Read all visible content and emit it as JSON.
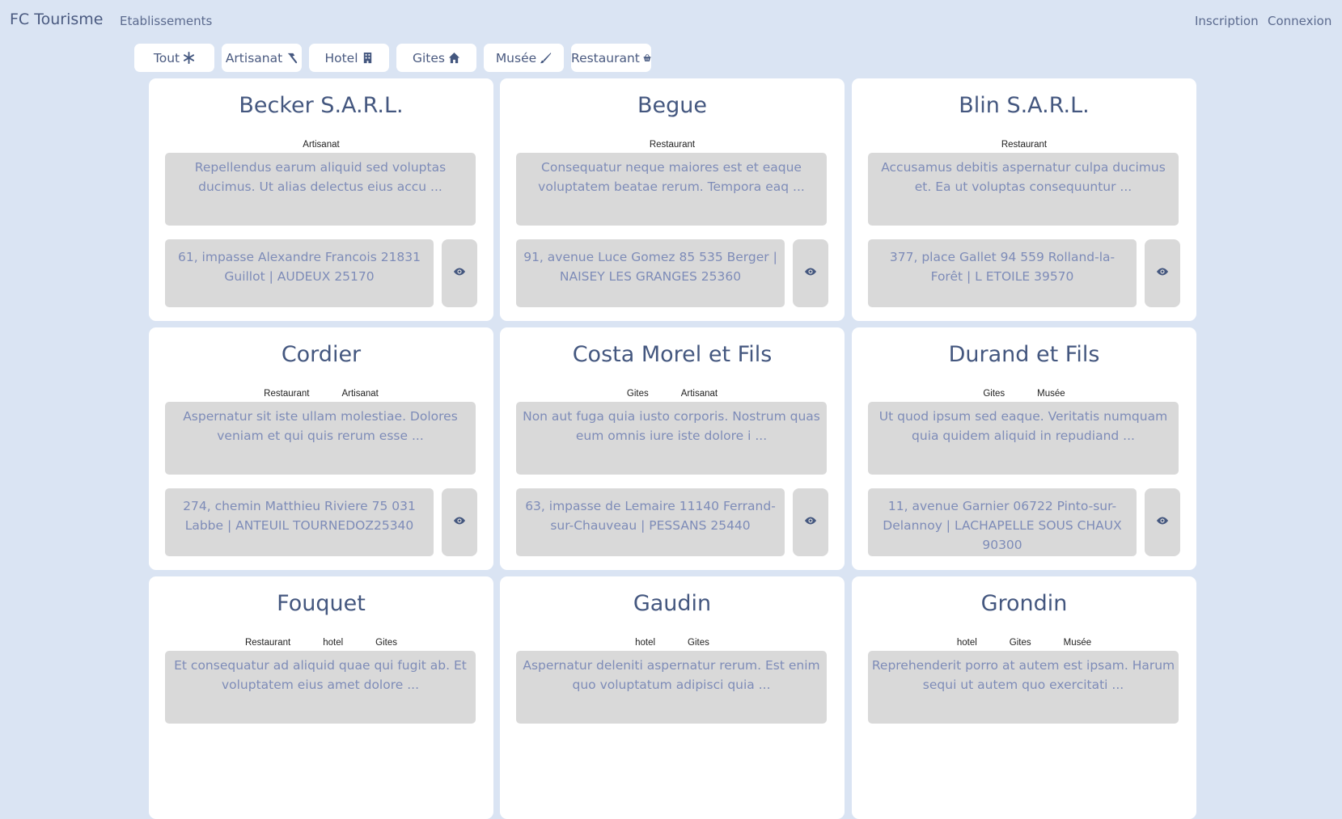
{
  "navbar": {
    "brand": "FC Tourisme",
    "establishments": "Etablissements",
    "signup": "Inscription",
    "login": "Connexion"
  },
  "filters": [
    {
      "label": "Tout",
      "icon": "asterisk-icon"
    },
    {
      "label": "Artisanat",
      "icon": "hammer-icon"
    },
    {
      "label": "Hotel",
      "icon": "building-icon"
    },
    {
      "label": "Gites",
      "icon": "house-icon"
    },
    {
      "label": "Musée",
      "icon": "brush-icon"
    },
    {
      "label": "Restaurant",
      "icon": "basket-icon"
    }
  ],
  "cards": [
    {
      "title": "Becker S.A.R.L.",
      "tags": [
        "Artisanat"
      ],
      "description": "Repellendus earum aliquid sed voluptas ducimus. Ut alias delectus eius accu ...",
      "address": "61, impasse Alexandre Francois 21831 Guillot | AUDEUX 25170"
    },
    {
      "title": "Begue",
      "tags": [
        "Restaurant"
      ],
      "description": "Consequatur neque maiores est et eaque voluptatem beatae rerum. Tempora eaq ...",
      "address": "91, avenue Luce Gomez 85 535 Berger | NAISEY LES GRANGES 25360"
    },
    {
      "title": "Blin S.A.R.L.",
      "tags": [
        "Restaurant"
      ],
      "description": "Accusamus debitis aspernatur culpa ducimus et. Ea ut voluptas consequuntur ...",
      "address": "377, place Gallet 94 559 Rolland-la-Forêt | L ETOILE 39570"
    },
    {
      "title": "Cordier",
      "tags": [
        "Restaurant",
        "Artisanat"
      ],
      "description": "Aspernatur sit iste ullam molestiae. Dolores veniam et qui quis rerum esse ...",
      "address": "274, chemin Matthieu Riviere 75 031 Labbe | ANTEUIL TOURNEDOZ25340"
    },
    {
      "title": "Costa Morel et Fils",
      "tags": [
        "Gites",
        "Artisanat"
      ],
      "description": "Non aut fuga quia iusto corporis. Nostrum quas eum omnis iure iste dolore i ...",
      "address": "63, impasse de Lemaire 11140 Ferrand-sur-Chauveau | PESSANS 25440"
    },
    {
      "title": "Durand et Fils",
      "tags": [
        "Gites",
        "Musée"
      ],
      "description": "Ut quod ipsum sed eaque. Veritatis numquam quia quidem aliquid in repudiand ...",
      "address": "11, avenue Garnier 06722 Pinto-sur-Delannoy | LACHAPELLE SOUS CHAUX 90300"
    },
    {
      "title": "Fouquet",
      "tags": [
        "Restaurant",
        "hotel",
        "Gites"
      ],
      "description": "Et consequatur ad aliquid quae qui fugit ab. Et voluptatem eius amet dolore ...",
      "address": ""
    },
    {
      "title": "Gaudin",
      "tags": [
        "hotel",
        "Gites"
      ],
      "description": "Aspernatur deleniti aspernatur rerum. Est enim quo voluptatum adipisci quia ...",
      "address": ""
    },
    {
      "title": "Grondin",
      "tags": [
        "hotel",
        "Gites",
        "Musée"
      ],
      "description": "Reprehenderit porro at autem est ipsam. Harum sequi ut autem quo exercitati ...",
      "address": ""
    }
  ],
  "colors": {
    "background": "#dae4f3",
    "accent": "#44577f",
    "panel": "#d9d9d9"
  }
}
